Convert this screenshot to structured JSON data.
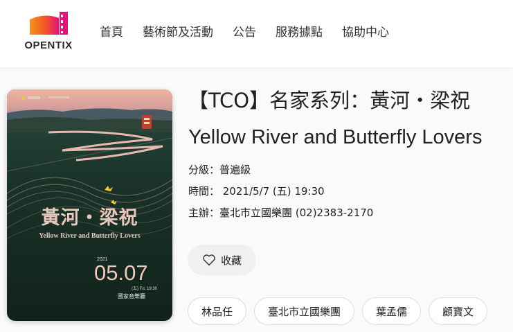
{
  "brand": {
    "name": "OPENTIX"
  },
  "nav": {
    "items": [
      "首頁",
      "藝術節及活動",
      "公告",
      "服務據點",
      "協助中心"
    ]
  },
  "poster": {
    "title": "黃河・梁祝",
    "subtitle": "Yellow River and Butterfly Lovers",
    "year": "2021",
    "date": "05.07",
    "time": "(五) Fri. 19:30",
    "venue": "國家音樂廳"
  },
  "event": {
    "title": "【TCO】名家系列：黃河・梁祝",
    "subtitle": "Yellow River and Butterfly Lovers",
    "rating": "分級：普遍級",
    "time": "時間： 2021/5/7 (五) 19:30",
    "organizer": "主辦：臺北市立國樂團 (02)2383-2170"
  },
  "favorite": {
    "label": "收藏"
  },
  "tags": [
    "林品任",
    "臺北市立國樂團",
    "葉孟儒",
    "顧寶文"
  ],
  "colors": {
    "brand_orange": "#f15a24",
    "brand_pink": "#e2127a",
    "poster_bg": "#152a22",
    "poster_sky": "#e8a79a"
  }
}
